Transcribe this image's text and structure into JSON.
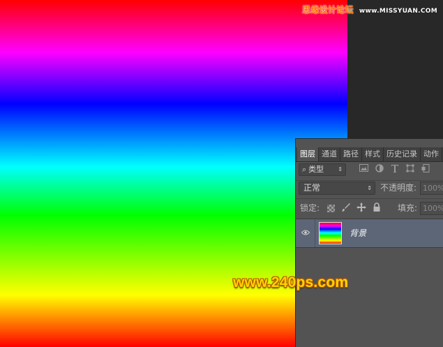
{
  "watermark_top": {
    "brand": "思缘设计论坛",
    "url": "www.MISSYUAN.COM"
  },
  "watermark_bottom": "www.240ps.com",
  "colors": {
    "canvas_stops": [
      "#ff0000",
      "#ff00ff",
      "#0000ff",
      "#00ffff",
      "#00ff00",
      "#ffff00",
      "#ff0000"
    ],
    "selected_layer_bg": "#5c6677",
    "panel_bg": "#535353"
  },
  "layers_panel": {
    "tabs": [
      {
        "label": "图层",
        "active": true
      },
      {
        "label": "通道",
        "active": false
      },
      {
        "label": "路径",
        "active": false
      },
      {
        "label": "样式",
        "active": false
      },
      {
        "label": "历史记录",
        "active": false
      },
      {
        "label": "动作",
        "active": false
      }
    ],
    "filter": {
      "search_icon": "⌕",
      "value": "类型",
      "icons": [
        "image-icon",
        "adjustment-icon",
        "type-icon",
        "shape-icon",
        "smart-object-icon"
      ]
    },
    "blend_mode": "正常",
    "opacity_label": "不透明度:",
    "opacity_value": "100%",
    "lock_label": "锁定:",
    "lock_icons": [
      "lock-transparent-icon",
      "lock-paint-icon",
      "lock-move-icon",
      "lock-all-icon"
    ],
    "fill_label": "填充:",
    "fill_value": "100%",
    "layers": [
      {
        "name": "背景",
        "visible": true,
        "selected": true
      }
    ]
  }
}
